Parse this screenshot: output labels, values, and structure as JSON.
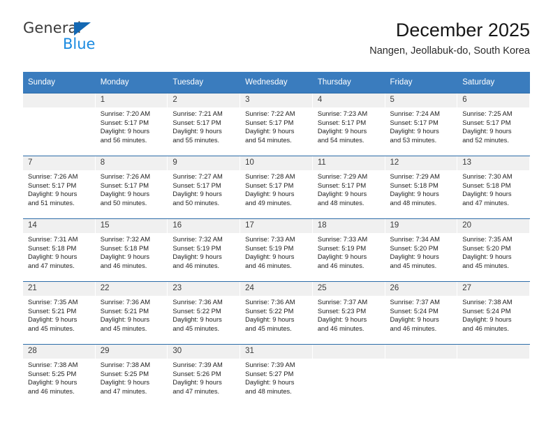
{
  "brand": {
    "name_top": "General",
    "name_bottom": "Blue",
    "triangle_color": "#1468b3",
    "blue_text_color": "#1a8ae0"
  },
  "header": {
    "title": "December 2025",
    "subtitle": "Nangen, Jeollabuk-do, South Korea",
    "header_bg_color": "#3a7cbe",
    "row_divider_color": "#2c6ca8",
    "daynum_bg_color": "#f0f0f0"
  },
  "weekday_headers": [
    "Sunday",
    "Monday",
    "Tuesday",
    "Wednesday",
    "Thursday",
    "Friday",
    "Saturday"
  ],
  "weeks": [
    [
      {
        "day": "",
        "sunrise": "",
        "sunset": "",
        "daylight1": "",
        "daylight2": ""
      },
      {
        "day": "1",
        "sunrise": "Sunrise: 7:20 AM",
        "sunset": "Sunset: 5:17 PM",
        "daylight1": "Daylight: 9 hours",
        "daylight2": "and 56 minutes."
      },
      {
        "day": "2",
        "sunrise": "Sunrise: 7:21 AM",
        "sunset": "Sunset: 5:17 PM",
        "daylight1": "Daylight: 9 hours",
        "daylight2": "and 55 minutes."
      },
      {
        "day": "3",
        "sunrise": "Sunrise: 7:22 AM",
        "sunset": "Sunset: 5:17 PM",
        "daylight1": "Daylight: 9 hours",
        "daylight2": "and 54 minutes."
      },
      {
        "day": "4",
        "sunrise": "Sunrise: 7:23 AM",
        "sunset": "Sunset: 5:17 PM",
        "daylight1": "Daylight: 9 hours",
        "daylight2": "and 54 minutes."
      },
      {
        "day": "5",
        "sunrise": "Sunrise: 7:24 AM",
        "sunset": "Sunset: 5:17 PM",
        "daylight1": "Daylight: 9 hours",
        "daylight2": "and 53 minutes."
      },
      {
        "day": "6",
        "sunrise": "Sunrise: 7:25 AM",
        "sunset": "Sunset: 5:17 PM",
        "daylight1": "Daylight: 9 hours",
        "daylight2": "and 52 minutes."
      }
    ],
    [
      {
        "day": "7",
        "sunrise": "Sunrise: 7:26 AM",
        "sunset": "Sunset: 5:17 PM",
        "daylight1": "Daylight: 9 hours",
        "daylight2": "and 51 minutes."
      },
      {
        "day": "8",
        "sunrise": "Sunrise: 7:26 AM",
        "sunset": "Sunset: 5:17 PM",
        "daylight1": "Daylight: 9 hours",
        "daylight2": "and 50 minutes."
      },
      {
        "day": "9",
        "sunrise": "Sunrise: 7:27 AM",
        "sunset": "Sunset: 5:17 PM",
        "daylight1": "Daylight: 9 hours",
        "daylight2": "and 50 minutes."
      },
      {
        "day": "10",
        "sunrise": "Sunrise: 7:28 AM",
        "sunset": "Sunset: 5:17 PM",
        "daylight1": "Daylight: 9 hours",
        "daylight2": "and 49 minutes."
      },
      {
        "day": "11",
        "sunrise": "Sunrise: 7:29 AM",
        "sunset": "Sunset: 5:17 PM",
        "daylight1": "Daylight: 9 hours",
        "daylight2": "and 48 minutes."
      },
      {
        "day": "12",
        "sunrise": "Sunrise: 7:29 AM",
        "sunset": "Sunset: 5:18 PM",
        "daylight1": "Daylight: 9 hours",
        "daylight2": "and 48 minutes."
      },
      {
        "day": "13",
        "sunrise": "Sunrise: 7:30 AM",
        "sunset": "Sunset: 5:18 PM",
        "daylight1": "Daylight: 9 hours",
        "daylight2": "and 47 minutes."
      }
    ],
    [
      {
        "day": "14",
        "sunrise": "Sunrise: 7:31 AM",
        "sunset": "Sunset: 5:18 PM",
        "daylight1": "Daylight: 9 hours",
        "daylight2": "and 47 minutes."
      },
      {
        "day": "15",
        "sunrise": "Sunrise: 7:32 AM",
        "sunset": "Sunset: 5:18 PM",
        "daylight1": "Daylight: 9 hours",
        "daylight2": "and 46 minutes."
      },
      {
        "day": "16",
        "sunrise": "Sunrise: 7:32 AM",
        "sunset": "Sunset: 5:19 PM",
        "daylight1": "Daylight: 9 hours",
        "daylight2": "and 46 minutes."
      },
      {
        "day": "17",
        "sunrise": "Sunrise: 7:33 AM",
        "sunset": "Sunset: 5:19 PM",
        "daylight1": "Daylight: 9 hours",
        "daylight2": "and 46 minutes."
      },
      {
        "day": "18",
        "sunrise": "Sunrise: 7:33 AM",
        "sunset": "Sunset: 5:19 PM",
        "daylight1": "Daylight: 9 hours",
        "daylight2": "and 46 minutes."
      },
      {
        "day": "19",
        "sunrise": "Sunrise: 7:34 AM",
        "sunset": "Sunset: 5:20 PM",
        "daylight1": "Daylight: 9 hours",
        "daylight2": "and 45 minutes."
      },
      {
        "day": "20",
        "sunrise": "Sunrise: 7:35 AM",
        "sunset": "Sunset: 5:20 PM",
        "daylight1": "Daylight: 9 hours",
        "daylight2": "and 45 minutes."
      }
    ],
    [
      {
        "day": "21",
        "sunrise": "Sunrise: 7:35 AM",
        "sunset": "Sunset: 5:21 PM",
        "daylight1": "Daylight: 9 hours",
        "daylight2": "and 45 minutes."
      },
      {
        "day": "22",
        "sunrise": "Sunrise: 7:36 AM",
        "sunset": "Sunset: 5:21 PM",
        "daylight1": "Daylight: 9 hours",
        "daylight2": "and 45 minutes."
      },
      {
        "day": "23",
        "sunrise": "Sunrise: 7:36 AM",
        "sunset": "Sunset: 5:22 PM",
        "daylight1": "Daylight: 9 hours",
        "daylight2": "and 45 minutes."
      },
      {
        "day": "24",
        "sunrise": "Sunrise: 7:36 AM",
        "sunset": "Sunset: 5:22 PM",
        "daylight1": "Daylight: 9 hours",
        "daylight2": "and 45 minutes."
      },
      {
        "day": "25",
        "sunrise": "Sunrise: 7:37 AM",
        "sunset": "Sunset: 5:23 PM",
        "daylight1": "Daylight: 9 hours",
        "daylight2": "and 46 minutes."
      },
      {
        "day": "26",
        "sunrise": "Sunrise: 7:37 AM",
        "sunset": "Sunset: 5:24 PM",
        "daylight1": "Daylight: 9 hours",
        "daylight2": "and 46 minutes."
      },
      {
        "day": "27",
        "sunrise": "Sunrise: 7:38 AM",
        "sunset": "Sunset: 5:24 PM",
        "daylight1": "Daylight: 9 hours",
        "daylight2": "and 46 minutes."
      }
    ],
    [
      {
        "day": "28",
        "sunrise": "Sunrise: 7:38 AM",
        "sunset": "Sunset: 5:25 PM",
        "daylight1": "Daylight: 9 hours",
        "daylight2": "and 46 minutes."
      },
      {
        "day": "29",
        "sunrise": "Sunrise: 7:38 AM",
        "sunset": "Sunset: 5:25 PM",
        "daylight1": "Daylight: 9 hours",
        "daylight2": "and 47 minutes."
      },
      {
        "day": "30",
        "sunrise": "Sunrise: 7:39 AM",
        "sunset": "Sunset: 5:26 PM",
        "daylight1": "Daylight: 9 hours",
        "daylight2": "and 47 minutes."
      },
      {
        "day": "31",
        "sunrise": "Sunrise: 7:39 AM",
        "sunset": "Sunset: 5:27 PM",
        "daylight1": "Daylight: 9 hours",
        "daylight2": "and 48 minutes."
      },
      {
        "day": "",
        "sunrise": "",
        "sunset": "",
        "daylight1": "",
        "daylight2": ""
      },
      {
        "day": "",
        "sunrise": "",
        "sunset": "",
        "daylight1": "",
        "daylight2": ""
      },
      {
        "day": "",
        "sunrise": "",
        "sunset": "",
        "daylight1": "",
        "daylight2": ""
      }
    ]
  ]
}
